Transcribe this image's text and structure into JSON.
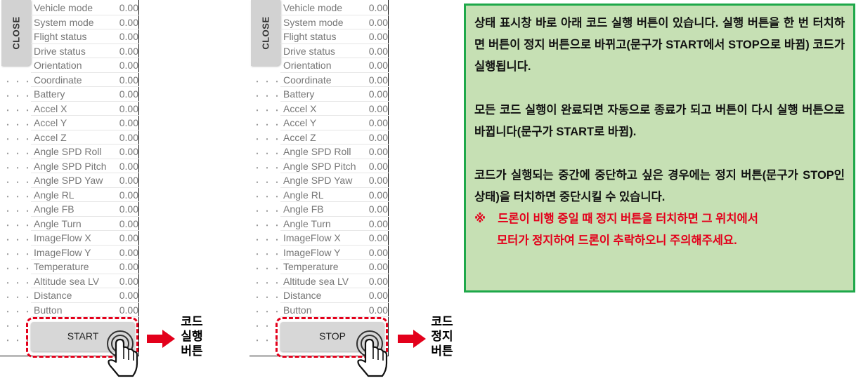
{
  "left_panel": {
    "close_label": "CLOSE",
    "button_label": "START",
    "callout": [
      "코드",
      "실행",
      "버튼"
    ]
  },
  "right_panel": {
    "close_label": "CLOSE",
    "button_label": "STOP",
    "callout": [
      "코드",
      "정지",
      "버튼"
    ]
  },
  "sensor_rows": [
    {
      "label": "Vehicle mode",
      "value": "0.00"
    },
    {
      "label": "System mode",
      "value": "0.00"
    },
    {
      "label": "Flight status",
      "value": "0.00"
    },
    {
      "label": "Drive status",
      "value": "0.00"
    },
    {
      "label": "Orientation",
      "value": "0.00"
    },
    {
      "label": "Coordinate",
      "value": "0.00"
    },
    {
      "label": "Battery",
      "value": "0.00"
    },
    {
      "label": "Accel X",
      "value": "0.00"
    },
    {
      "label": "Accel Y",
      "value": "0.00"
    },
    {
      "label": "Accel Z",
      "value": "0.00"
    },
    {
      "label": "Angle SPD Roll",
      "value": "0.00"
    },
    {
      "label": "Angle SPD Pitch",
      "value": "0.00"
    },
    {
      "label": "Angle SPD Yaw",
      "value": "0.00"
    },
    {
      "label": "Angle RL",
      "value": "0.00"
    },
    {
      "label": "Angle FB",
      "value": "0.00"
    },
    {
      "label": "Angle Turn",
      "value": "0.00"
    },
    {
      "label": "ImageFlow X",
      "value": "0.00"
    },
    {
      "label": "ImageFlow Y",
      "value": "0.00"
    },
    {
      "label": "Temperature",
      "value": "0.00"
    },
    {
      "label": "Altitude sea LV",
      "value": "0.00"
    },
    {
      "label": "Distance",
      "value": "0.00"
    },
    {
      "label": "Button",
      "value": "0.00"
    }
  ],
  "note": {
    "paragraph1": "상태 표시창 바로 아래 코드 실행 버튼이 있습니다. 실행 버튼을 한 번 터치하면 버튼이 정지 버튼으로 바뀌고(문구가 START에서 STOP으로 바뀜) 코드가 실행됩니다.",
    "paragraph2": "모든 코드 실행이 완료되면 자동으로 종료가 되고 버튼이 다시 실행 버튼으로 바뀝니다(문구가 START로 바뀜).",
    "paragraph3": "코드가 실행되는 중간에 중단하고 싶은 경우에는 정지 버튼(문구가 STOP인 상태)을 터치하면 중단시킬 수 있습니다.",
    "warning_symbol": "※",
    "warning_line1": "드론이 비행 중일 때 정지 버튼을 터치하면 그 위치에서",
    "warning_line2": "모터가 정지하여 드론이 추락하오니 주의해주세요."
  },
  "colors": {
    "highlight_red": "#e3001b",
    "note_background": "#c6e0b4",
    "note_border": "#1ea84a",
    "button_gray": "#d7d7d7"
  }
}
